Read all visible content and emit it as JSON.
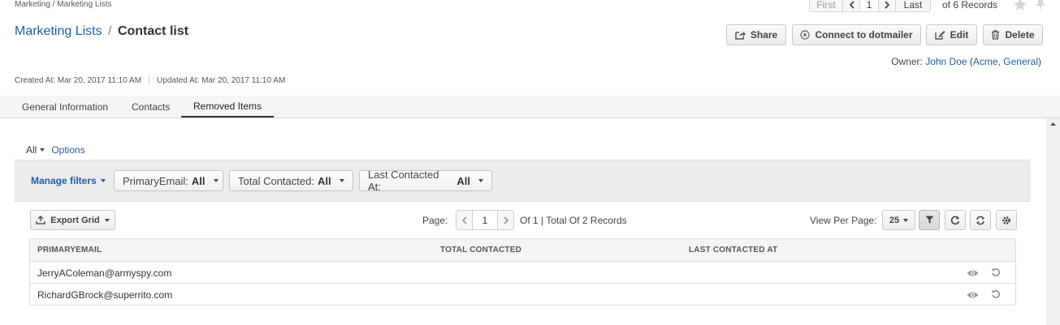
{
  "breadcrumb": {
    "root": "Marketing",
    "sep": "/",
    "current": "Marketing Lists"
  },
  "pager_top": {
    "first": "First",
    "page": "1",
    "last": "Last",
    "records": "of 6 Records"
  },
  "title": {
    "parent": "Marketing Lists",
    "sep": "/",
    "current": "Contact list"
  },
  "actions": {
    "share": "Share",
    "connect": "Connect to dotmailer",
    "edit": "Edit",
    "delete": "Delete"
  },
  "owner": {
    "label": "Owner:",
    "name": "John Doe",
    "open": "(",
    "org1": "Acme",
    "comma": ",",
    "org2": "General",
    "close": ")"
  },
  "meta": {
    "created": "Created At: Mar 20, 2017 11:10 AM",
    "updated": "Updated At: Mar 20, 2017 11:10 AM"
  },
  "tabs": [
    "General Information",
    "Contacts",
    "Removed Items"
  ],
  "grid_toolbar": {
    "all": "All",
    "options": "Options"
  },
  "filters": {
    "manage": "Manage filters",
    "items": [
      {
        "label": "PrimaryEmail:",
        "value": "All"
      },
      {
        "label": "Total Contacted:",
        "value": "All"
      },
      {
        "label": "Last Contacted At:",
        "value": "All"
      }
    ]
  },
  "grid": {
    "export": "Export Grid",
    "page_label": "Page:",
    "page_value": "1",
    "page_info": "Of 1 | Total Of 2 Records",
    "view_per_page_label": "View Per Page:",
    "view_per_page_value": "25",
    "columns": [
      "PRIMARYEMAIL",
      "TOTAL CONTACTED",
      "LAST CONTACTED AT"
    ],
    "rows": [
      {
        "email": "JerryAColeman@armyspy.com",
        "total": "",
        "last": ""
      },
      {
        "email": "RichardGBrock@superrito.com",
        "total": "",
        "last": ""
      }
    ]
  },
  "icons": [
    "star-icon",
    "pin-icon",
    "share-icon",
    "connect-icon",
    "edit-icon",
    "trash-icon",
    "export-icon",
    "filter-icon",
    "refresh-icon",
    "reset-icon",
    "gear-icon",
    "eye-icon",
    "restore-icon"
  ],
  "colors": {
    "link": "#1e5fa8",
    "tab_active_underline": "#333333",
    "filter_bar": "#ececec"
  }
}
